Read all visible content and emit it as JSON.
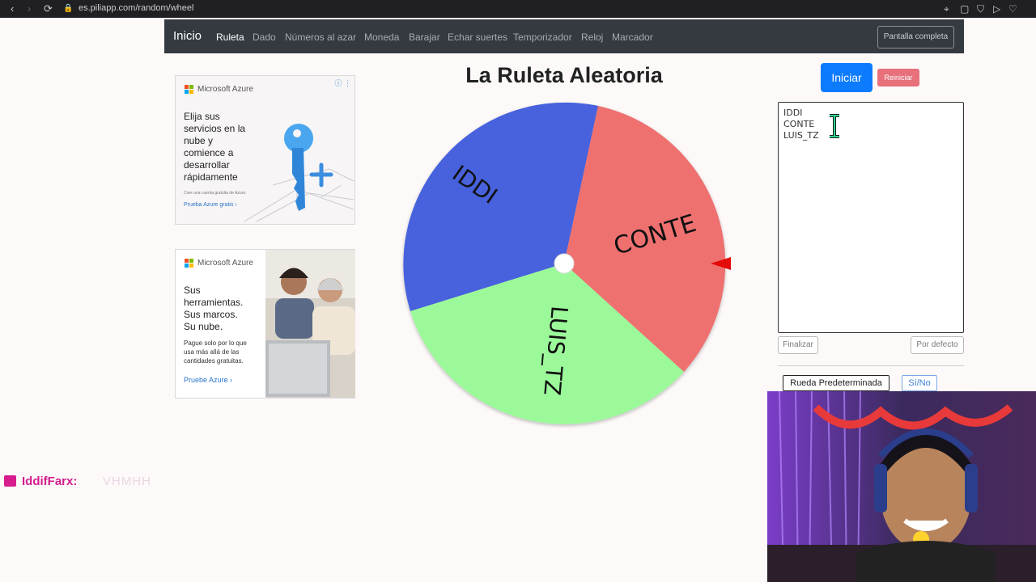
{
  "browser": {
    "url": "es.piliapp.com/random/wheel",
    "back_icon": "‹",
    "forward_icon": "›",
    "reload_icon": "⟳",
    "lock_icon": "🔒"
  },
  "navbar": {
    "brand": "Inicio",
    "links": [
      "Ruleta",
      "Dado",
      "Números al azar",
      "Moneda",
      "Barajar",
      "Echar suertes",
      "Temporizador",
      "Reloj",
      "Marcador"
    ],
    "active": "Ruleta",
    "fullscreen": "Pantalla completa"
  },
  "ads": {
    "ad1": {
      "brand": "Microsoft Azure",
      "text": "Elija sus\nservicios en la\nnube y\ncomience a\ndesarrollar\nrápidamente",
      "small": "Cree una cuenta gratuita de Azure.",
      "link": "Prueba Azure gratis ›"
    },
    "ad2": {
      "brand": "Microsoft Azure",
      "text": "Sus\nherramientas.\nSus marcos.\nSu nube.",
      "small": "Pague solo por lo que\nusa más allá de las\ncantidades gratuitas.",
      "link": "Pruebe Azure ›"
    },
    "ad_choice": "ⓘ ⋮"
  },
  "title": "La Ruleta Aleatoria",
  "wheel": {
    "segments": [
      {
        "label": "IDDI",
        "color": "#4762dc"
      },
      {
        "label": "CONTE",
        "color": "#ee7170"
      },
      {
        "label": "LUIS_TZ",
        "color": "#9cf99a"
      }
    ],
    "pointer_color": "#e40b0b"
  },
  "controls": {
    "start": "Iniciar",
    "reset": "Reiniciar",
    "entries_text": "IDDI\nCONTE\nLUIS_TZ",
    "finish": "Finalizar",
    "default": "Por defecto",
    "default_wheel": "Rueda Predeterminada",
    "yes_no": "Sí/No"
  },
  "chat": {
    "user": "IddifFarx:",
    "message": "VHMHH"
  }
}
